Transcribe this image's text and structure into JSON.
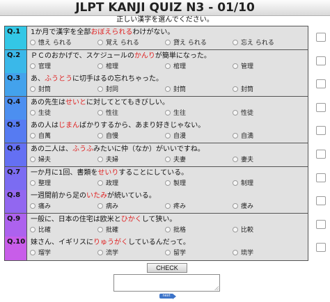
{
  "header": {
    "title": "JLPT KANJI QUIZ N3 - 01/10",
    "instruction": "正しい漢字を選んでください。"
  },
  "questions": [
    {
      "num": "Q.1",
      "color": "#33c7e6",
      "pre": "1か月で漢字を全部",
      "hl": "おぼえられる",
      "post": "わけがない。",
      "options": [
        "憶え られる",
        "覚え られる",
        "貸え られる",
        "忘え られる"
      ]
    },
    {
      "num": "Q.2",
      "color": "#3ab8e9",
      "pre": "ＰＣのおかげで、スケジュールの",
      "hl": "かんり",
      "post": "が簡単になった。",
      "options": [
        "官理",
        "棺理",
        "棺理",
        "管理"
      ]
    },
    {
      "num": "Q.3",
      "color": "#43a2ec",
      "pre": "あ、",
      "hl": "ふうとう",
      "post": "に切手はるの忘れちゃった。",
      "options": [
        "封筒",
        "封同",
        "封筒",
        "封筒"
      ]
    },
    {
      "num": "Q.4",
      "color": "#4c8ff0",
      "pre": "あの先生は",
      "hl": "せいと",
      "post": "に対してとてもきびしい。",
      "options": [
        "生徒",
        "性往",
        "生往",
        "性徒"
      ]
    },
    {
      "num": "Q.5",
      "color": "#567bf2",
      "pre": "あの人は",
      "hl": "じまん",
      "post": "ばかりするから、あまり好きじゃない。",
      "options": [
        "自萬",
        "自慢",
        "自漫",
        "自満"
      ]
    },
    {
      "num": "Q.6",
      "color": "#6470f3",
      "pre": "あの二人は、",
      "hl": "ふうふ",
      "post": "みたいに仲（なか）がいいですね。",
      "options": [
        "婦夫",
        "夫婦",
        "夫妻",
        "妻夫"
      ]
    },
    {
      "num": "Q.7",
      "color": "#7b6cf2",
      "pre": "一か月に1回、書類を",
      "hl": "せいり",
      "post": "することにしている。",
      "options": [
        "整理",
        "政理",
        "製理",
        "制理"
      ]
    },
    {
      "num": "Q.8",
      "color": "#9267f0",
      "pre": "一週間前から足の",
      "hl": "いたみ",
      "post": "が続いている。",
      "options": [
        "痛み",
        "病み",
        "疼み",
        "痩み"
      ]
    },
    {
      "num": "Q.9",
      "color": "#ad62ee",
      "pre": "一般に、日本の住宅は欧米と",
      "hl": "ひかく",
      "post": "して狭い。",
      "options": [
        "比確",
        "批確",
        "批格",
        "比較"
      ]
    },
    {
      "num": "Q.10",
      "color": "#c85de9",
      "pre": "妹さん、イギリスに",
      "hl": "りゅうがく",
      "post": "しているんだって。",
      "options": [
        "瑠学",
        "流学",
        "留学",
        "琉学"
      ]
    }
  ],
  "check_button": "CHECK",
  "next_link": "next",
  "colors": {
    "highlight": "#e02020",
    "row_bg": "#e1e1e1"
  }
}
